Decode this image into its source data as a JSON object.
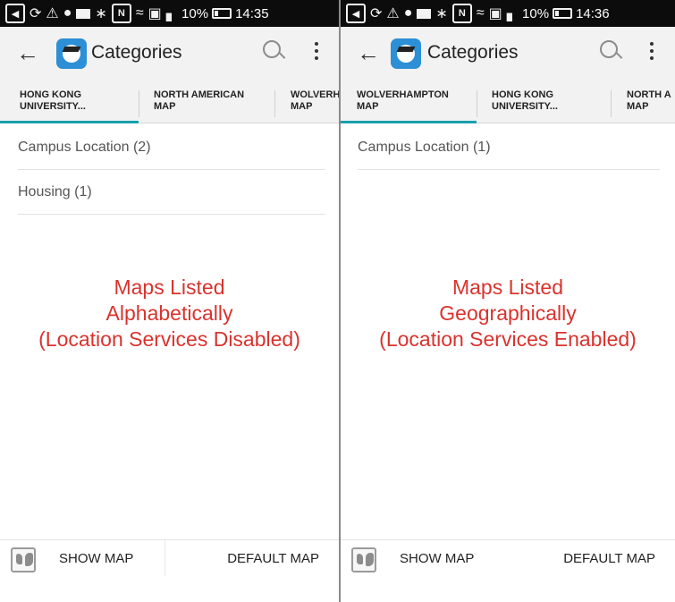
{
  "colors": {
    "annotation": "#d9332e",
    "tab_indicator": "#19a0ad",
    "app_logo": "#2d8fd5",
    "status_bar": "#0c0c0c",
    "app_bar": "#f2f2f2"
  },
  "panels": [
    {
      "status_bar": {
        "icons": [
          "nfc-icon",
          "link-icon",
          "warning-icon",
          "person-icon",
          "notification-icon",
          "bluetooth-icon",
          "n-icon",
          "wifi-icon",
          "cast-icon",
          "signal-icon"
        ],
        "battery_text": "10%",
        "time": "14:35"
      },
      "app_bar": {
        "title": "Categories"
      },
      "tabs": [
        {
          "label": "HONG KONG\nUNIVERSITY..."
        },
        {
          "label": "NORTH AMERICAN\nMAP"
        },
        {
          "label": "WOLVERH\nMAP"
        }
      ],
      "list_items": [
        {
          "label": "Campus Location (2)"
        },
        {
          "label": "Housing (1)"
        }
      ],
      "annotation": "Maps Listed\nAlphabetically\n(Location Services Disabled)",
      "bottom_bar": {
        "show_map_label": "SHOW MAP",
        "default_map_label": "DEFAULT MAP"
      }
    },
    {
      "status_bar": {
        "icons": [
          "nfc-icon",
          "link-icon",
          "warning-icon",
          "person-icon",
          "notification-icon",
          "bluetooth-icon",
          "n-icon",
          "wifi-icon",
          "cast-icon",
          "signal-icon"
        ],
        "battery_text": "10%",
        "time": "14:36"
      },
      "app_bar": {
        "title": "Categories"
      },
      "tabs": [
        {
          "label": "WOLVERHAMPTON\nMAP"
        },
        {
          "label": "HONG KONG\nUNIVERSITY..."
        },
        {
          "label": "NORTH A\nMAP"
        }
      ],
      "list_items": [
        {
          "label": "Campus Location (1)"
        }
      ],
      "annotation": "Maps Listed\nGeographically\n(Location Services Enabled)",
      "bottom_bar": {
        "show_map_label": "SHOW MAP",
        "default_map_label": "DEFAULT MAP"
      }
    }
  ]
}
